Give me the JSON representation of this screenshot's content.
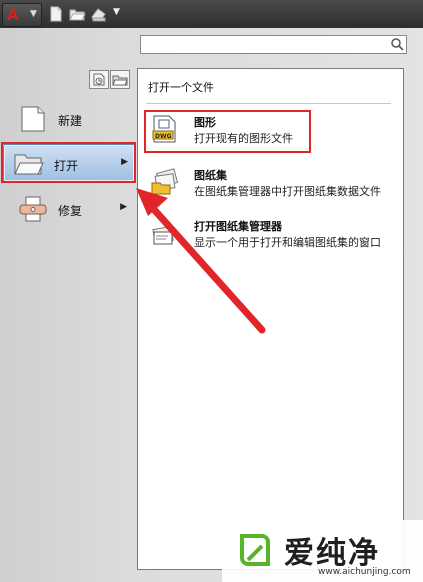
{
  "toolbar": {
    "app_logo": "A",
    "quick_access_icons": [
      "new-document-icon",
      "open-folder-icon",
      "save-icon"
    ],
    "dropdown_glyph": "▼"
  },
  "search": {
    "value": "",
    "placeholder": ""
  },
  "left_menu": {
    "items": [
      {
        "label": "新建",
        "icon": "new-document-icon",
        "has_submenu": false,
        "selected": false
      },
      {
        "label": "打开",
        "icon": "open-folder-icon",
        "has_submenu": true,
        "selected": true
      },
      {
        "label": "修复",
        "icon": "repair-icon",
        "has_submenu": true,
        "selected": false
      }
    ],
    "submenu_glyph": "▶"
  },
  "right_panel": {
    "header": "打开一个文件",
    "items": [
      {
        "title": "图形",
        "desc": "打开现有的图形文件",
        "icon": "dwg-file-icon",
        "icon_text": "DWG"
      },
      {
        "title": "图纸集",
        "desc": "在图纸集管理器中打开图纸集数据文件",
        "icon": "sheet-set-icon"
      },
      {
        "title": "打开图纸集管理器",
        "desc": "显示一个用于打开和编辑图纸集的窗口",
        "icon": "sheet-set-manager-icon"
      }
    ]
  },
  "watermark": {
    "text": "爱纯净",
    "url": "www.aichunjing.com"
  },
  "colors": {
    "highlight_red": "#e0262a",
    "selection_blue": "#9ebfe3",
    "titlebar_dark": "#3a3a3a"
  }
}
